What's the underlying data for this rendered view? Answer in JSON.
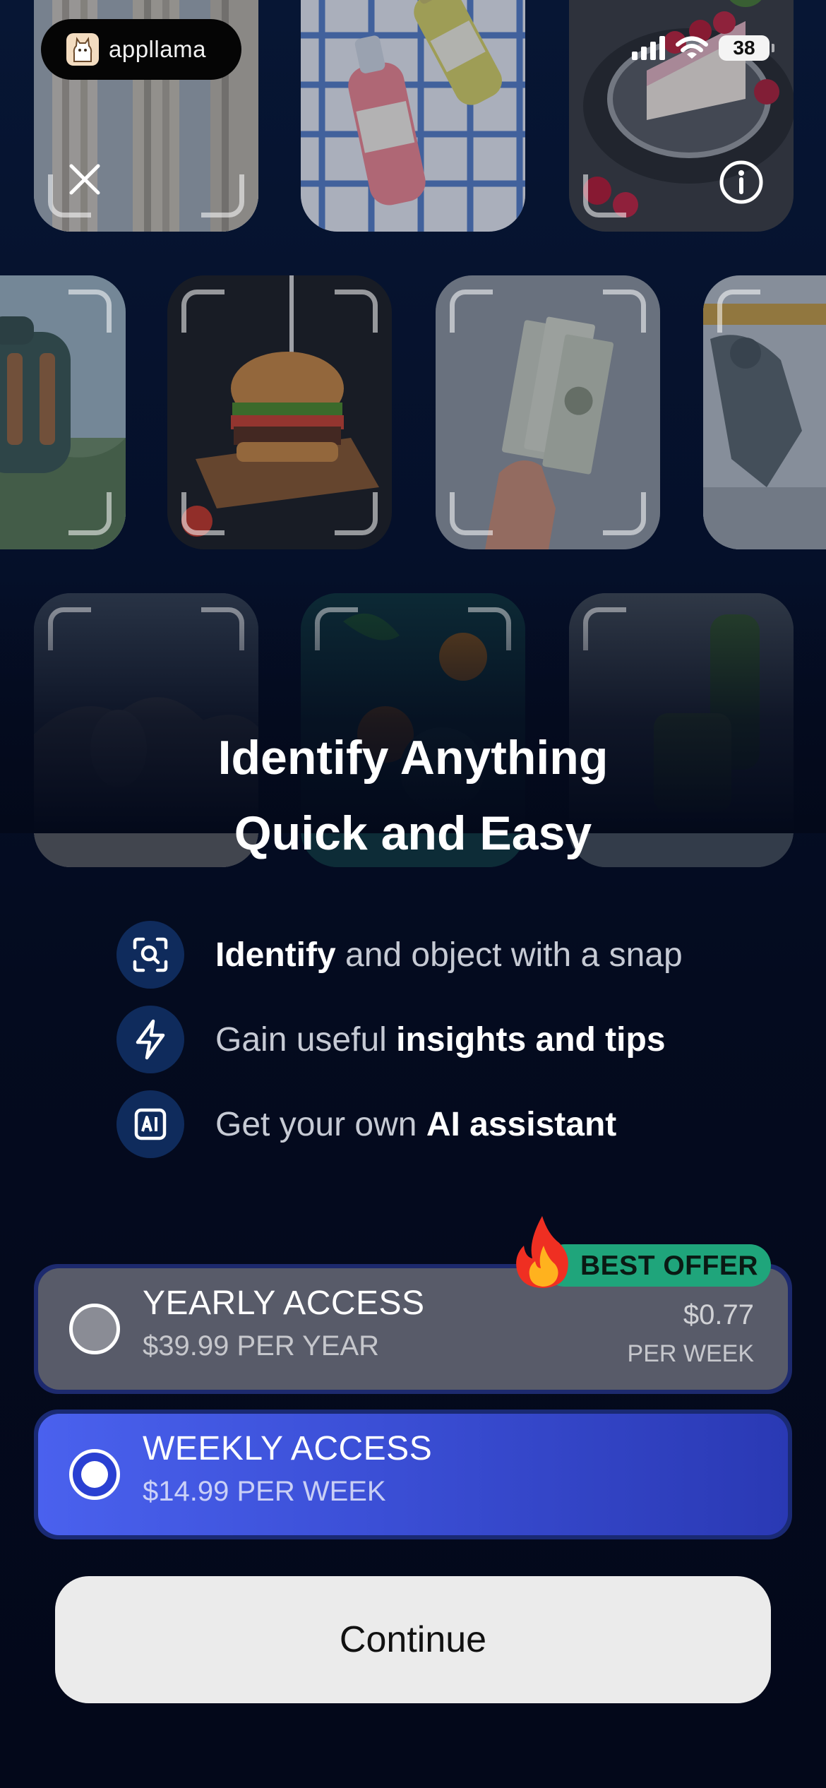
{
  "status_bar": {
    "app_name": "appllama",
    "battery": "38"
  },
  "icons": {
    "close": "close-icon",
    "info": "info-icon",
    "scan": "scan-search-icon",
    "bolt": "lightning-bolt-icon",
    "ai": "ai-chip-icon",
    "fire": "fire-icon"
  },
  "headline": {
    "line1": "Identify Anything",
    "line2": "Quick and Easy"
  },
  "features": [
    {
      "bold": "Identify",
      "rest": " and object with a snap"
    },
    {
      "pre": "Gain useful ",
      "bold": "insights and tips"
    },
    {
      "pre": "Get your own ",
      "bold": "AI assistant"
    }
  ],
  "plans": {
    "badge": "BEST OFFER",
    "yearly": {
      "name": "YEARLY ACCESS",
      "price": "$39.99 PER YEAR",
      "per_week_price": "$0.77",
      "per_week_label": "PER WEEK",
      "selected": false
    },
    "weekly": {
      "name": "WEEKLY ACCESS",
      "price": "$14.99 PER WEEK",
      "selected": true
    }
  },
  "continue_label": "Continue",
  "colors": {
    "background": "#03091b",
    "accent_blue": "#4a61ee",
    "badge_green": "#1fa57b",
    "plan_gray": "#585b69",
    "button_light": "#ebebeb"
  }
}
